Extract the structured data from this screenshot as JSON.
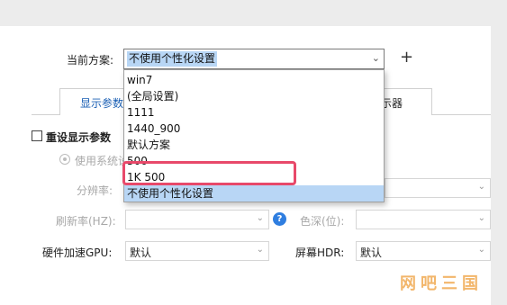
{
  "scheme": {
    "label": "当前方案:",
    "selected": "不使用个性化设置",
    "add_symbol": "+"
  },
  "tabs": [
    {
      "label": "显示参数",
      "active": true
    },
    {
      "label": "显示器",
      "active": false
    }
  ],
  "reset": {
    "label": "重设显示参数",
    "checked": false
  },
  "use_system": {
    "label": "使用系统设置"
  },
  "resolution": {
    "label": "分辨率:"
  },
  "refresh": {
    "label": "刷新率(HZ):",
    "value": ""
  },
  "color_depth": {
    "label": "色深(位):",
    "value": ""
  },
  "gpu_accel": {
    "label": "硬件加速GPU:",
    "value": "默认"
  },
  "hdr": {
    "label": "屏幕HDR:",
    "value": "默认"
  },
  "dropdown": {
    "options": [
      "win7",
      "(全局设置)",
      "1111",
      "1440_900",
      "默认方案",
      "500",
      "1K 500",
      "不使用个性化设置"
    ],
    "selected_index": 7,
    "highlighted_index": 6
  },
  "watermark": "网吧三国",
  "colors": {
    "selection": "#b8d6f5",
    "highlight_box": "#e8496a",
    "tab_active_text": "#1a5fb4",
    "help_icon": "#2f7ee0",
    "watermark": "#f2b66b"
  }
}
